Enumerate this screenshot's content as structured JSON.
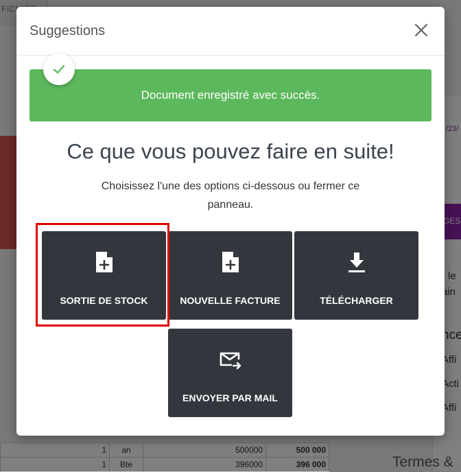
{
  "background": {
    "tab_label": "FICHIER",
    "right_date": "/23/",
    "purple_button_label": "GES",
    "right_lines": [
      "r le",
      "ain",
      "nce",
      "Affi",
      "Acti",
      "Affi"
    ],
    "table_rows": [
      {
        "qty": "1",
        "unit": "an",
        "price": "500000",
        "total": "500 000"
      },
      {
        "qty": "1",
        "unit": "Bte",
        "price": "396000",
        "total": "396 000"
      }
    ],
    "termes_label": "Termes &"
  },
  "modal": {
    "title": "Suggestions",
    "alert_text": "Document enregistré avec succès.",
    "headline": "Ce que vous pouvez faire en suite!",
    "subtext": "Choisissez l'une des options ci-dessous ou fermer ce panneau.",
    "actions": [
      {
        "label": "SORTIE DE STOCK",
        "icon": "file-plus-icon"
      },
      {
        "label": "NOUVELLE FACTURE",
        "icon": "file-plus-icon"
      },
      {
        "label": "TÉLÉCHARGER",
        "icon": "download-icon"
      },
      {
        "label": "ENVOYER PAR MAIL",
        "icon": "mail-send-icon"
      }
    ]
  },
  "colors": {
    "success": "#5cb85c",
    "action_bg": "#33373d",
    "highlight": "#e30000",
    "accent_purple": "#8e24aa"
  }
}
